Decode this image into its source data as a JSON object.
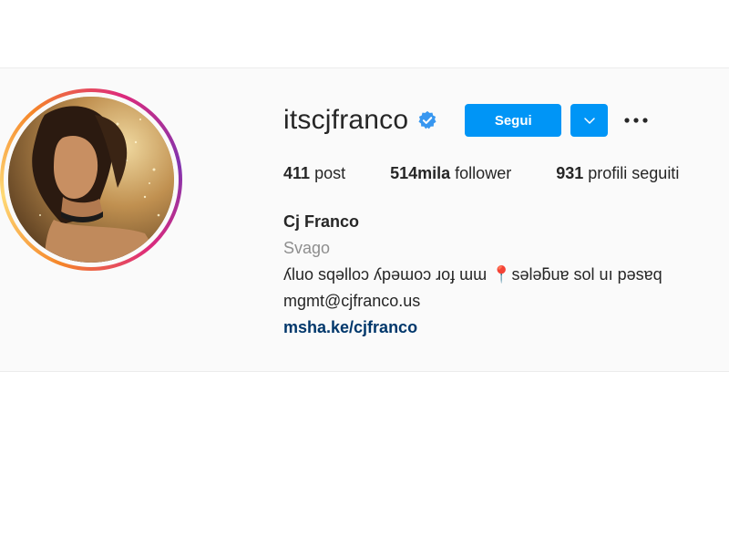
{
  "profile": {
    "username": "itscjfranco",
    "verified": true,
    "follow_label": "Segui",
    "stats": [
      {
        "num": "411",
        "label": "post"
      },
      {
        "num": "514mila",
        "label": "follower"
      },
      {
        "num": "931",
        "label": "profili seguiti"
      }
    ],
    "full_name": "Cj Franco",
    "category": "Svago",
    "bio_line": "ʎluo sqǝlloɔ ʎpǝɯoɔ ɹoɟ ɯɯ 📍sǝlǝƃuɐ sol uı pǝsɐq",
    "email": "mgmt@cjfranco.us",
    "link": "msha.ke/cjfranco"
  },
  "colors": {
    "accent": "#0095f6",
    "link": "#00376b",
    "muted": "#8e8e8e",
    "band_bg": "#fafafa"
  },
  "icons": {
    "verified": "verified-badge-icon",
    "dropdown": "chevron-down-icon",
    "more": "more-options-icon"
  }
}
